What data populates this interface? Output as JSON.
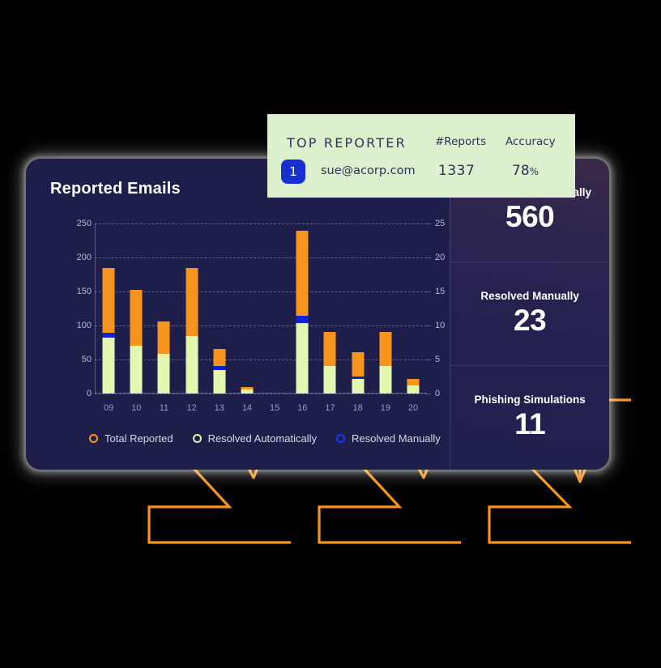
{
  "card": {
    "title": "Reported Emails"
  },
  "reporter": {
    "title": "TOP REPORTER",
    "col_reports": "#Reports",
    "col_accuracy": "Accuracy",
    "rank": "1",
    "email": "sue@acorp.com",
    "reports": "1337",
    "accuracy_value": "78",
    "accuracy_unit": "%"
  },
  "stats": [
    {
      "label": "Resolved Automatically",
      "value": "560"
    },
    {
      "label": "Resolved Manually",
      "value": "23"
    },
    {
      "label": "Phishing Simulations",
      "value": "11"
    }
  ],
  "legend": [
    {
      "label": "Total Reported",
      "color": "#f7941e",
      "key": "orange"
    },
    {
      "label": "Resolved Automatically",
      "color": "#e3f7b0",
      "key": "green"
    },
    {
      "label": "Resolved Manually",
      "color": "#1636ef",
      "key": "blue"
    }
  ],
  "colors": {
    "card_bg": "#1e1e4b",
    "panel_bg": "#dcf0cd",
    "total_reported": "#f7941e",
    "resolved_automatically": "#e3f7b0",
    "resolved_manually": "#0f22d5",
    "badge_blue": "#1a2fd0",
    "callout_orange": "#f7941e",
    "callout_red": "#e8380d",
    "callout_amber": "#f0a71c"
  },
  "chart_data": {
    "type": "bar",
    "title": "Reported Emails",
    "stacked": true,
    "xlabel": "",
    "ylabel": "",
    "grid": true,
    "legend_position": "bottom-left",
    "categories": [
      "09",
      "10",
      "11",
      "12",
      "13",
      "14",
      "15",
      "16",
      "17",
      "18",
      "19",
      "20"
    ],
    "y_left": {
      "ticks": [
        0,
        50,
        100,
        150,
        200,
        250
      ],
      "ylim": [
        0,
        250
      ],
      "applies_to": [
        "Total Reported",
        "Resolved Automatically",
        "Resolved Manually"
      ]
    },
    "y_right": {
      "ticks": [
        0,
        5,
        10,
        15,
        20,
        25
      ],
      "ylim": [
        0,
        25
      ]
    },
    "series": [
      {
        "name": "Resolved Automatically",
        "color": "#e3f7b0",
        "values": [
          82,
          70,
          58,
          85,
          35,
          6,
          0,
          103,
          41,
          21,
          40,
          12
        ]
      },
      {
        "name": "Resolved Manually",
        "color": "#0f22d5",
        "values": [
          7,
          0,
          0,
          0,
          5,
          0,
          0,
          11,
          0,
          4,
          0,
          0
        ]
      },
      {
        "name": "Total Reported",
        "color": "#f7941e",
        "values": [
          184,
          152,
          106,
          184,
          66,
          9,
          0,
          239,
          91,
          61,
          91,
          21
        ]
      }
    ],
    "note": "Total Reported is the full stacked bar height; orange segment is the remainder above the resolved segments."
  },
  "callouts": {
    "count": 3,
    "description": "three orange bracket lines pointing from below up to the dashboard card"
  }
}
